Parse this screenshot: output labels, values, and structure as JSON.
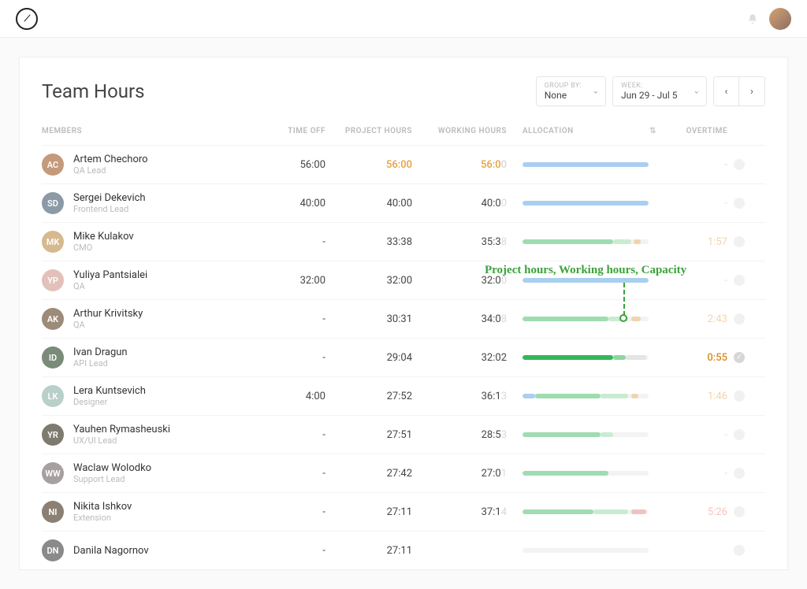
{
  "page_title": "Team Hours",
  "groupby": {
    "label": "GROUP BY:",
    "value": "None"
  },
  "weeksel": {
    "label": "WEEK:",
    "value": "Jun 29 - Jul 5"
  },
  "columns": {
    "members": "Members",
    "timeoff": "Time Off",
    "project_hours": "Project Hours",
    "working_hours": "Working Hours",
    "allocation": "Allocation",
    "overtime": "Overtime"
  },
  "annotation_text": "Project hours, Working hours, Capacity",
  "members": [
    {
      "name": "Artem Chechoro",
      "role": "QA Lead",
      "avatar": "AC",
      "timeoff": "56:00",
      "project": {
        "text": "56:00",
        "style": "highlight"
      },
      "working": {
        "main": "56:0",
        "suffix": "0",
        "style": "highlight"
      },
      "alloc": {
        "segs": [
          {
            "l": 0,
            "w": 100,
            "color": "#a9cff0"
          }
        ]
      },
      "overtime": {
        "text": "-",
        "cls": "ot-none"
      },
      "status": "empty"
    },
    {
      "name": "Sergei Dekevich",
      "role": "Frontend Lead",
      "avatar": "SD",
      "timeoff": "40:00",
      "project": {
        "text": "40:00",
        "style": ""
      },
      "working": {
        "main": "40:0",
        "suffix": "0"
      },
      "alloc": {
        "segs": [
          {
            "l": 0,
            "w": 100,
            "color": "#a9cff0"
          }
        ]
      },
      "overtime": {
        "text": "-",
        "cls": "ot-none"
      },
      "status": "empty"
    },
    {
      "name": "Mike Kulakov",
      "role": "CMO",
      "avatar": "MK",
      "timeoff": "-",
      "project": {
        "text": "33:38",
        "style": ""
      },
      "working": {
        "main": "35:3",
        "suffix": "8"
      },
      "alloc": {
        "segs": [
          {
            "l": 0,
            "w": 72,
            "color": "#9fdcb1"
          },
          {
            "l": 72,
            "w": 14,
            "color": "#c9ecd1"
          },
          {
            "l": 88,
            "w": 6,
            "color": "#f0d4ad"
          }
        ]
      },
      "overtime": {
        "text": "1:57",
        "cls": "ot-faint"
      },
      "status": "empty"
    },
    {
      "name": "Yuliya Pantsialei",
      "role": "QA",
      "avatar": "YP",
      "timeoff": "32:00",
      "project": {
        "text": "32:00",
        "style": ""
      },
      "working": {
        "main": "32:0",
        "suffix": "0"
      },
      "alloc": {
        "segs": [
          {
            "l": 0,
            "w": 100,
            "color": "#a9cff0"
          }
        ]
      },
      "overtime": {
        "text": "-",
        "cls": "ot-none"
      },
      "status": "empty"
    },
    {
      "name": "Arthur Krivitsky",
      "role": "QA",
      "avatar": "AK",
      "timeoff": "-",
      "project": {
        "text": "30:31",
        "style": ""
      },
      "working": {
        "main": "34:0",
        "suffix": "8"
      },
      "alloc": {
        "segs": [
          {
            "l": 0,
            "w": 68,
            "color": "#9fdcb1"
          },
          {
            "l": 68,
            "w": 16,
            "color": "#c9ecd1"
          },
          {
            "l": 86,
            "w": 8,
            "color": "#f0d4ad"
          }
        ]
      },
      "overtime": {
        "text": "2:43",
        "cls": "ot-faint"
      },
      "status": "empty"
    },
    {
      "name": "Ivan Dragun",
      "role": "API Lead",
      "avatar": "ID",
      "timeoff": "-",
      "project": {
        "text": "29:04",
        "style": ""
      },
      "working": {
        "main": "32:02",
        "suffix": ""
      },
      "alloc": {
        "segs": [
          {
            "l": 0,
            "w": 72,
            "color": "#34b65a"
          },
          {
            "l": 72,
            "w": 10,
            "color": "#8cd79e"
          },
          {
            "l": 82,
            "w": 16,
            "color": "#e5e5e5"
          }
        ]
      },
      "overtime": {
        "text": "0:55",
        "cls": "ot-strong"
      },
      "status": "checked"
    },
    {
      "name": "Lera Kuntsevich",
      "role": "Designer",
      "avatar": "LK",
      "timeoff": "4:00",
      "project": {
        "text": "27:52",
        "style": ""
      },
      "working": {
        "main": "36:1",
        "suffix": "3"
      },
      "alloc": {
        "segs": [
          {
            "l": 0,
            "w": 10,
            "color": "#a9cff0"
          },
          {
            "l": 10,
            "w": 52,
            "color": "#9fdcb1"
          },
          {
            "l": 62,
            "w": 22,
            "color": "#c9ecd1"
          },
          {
            "l": 86,
            "w": 6,
            "color": "#f0d4ad"
          }
        ]
      },
      "overtime": {
        "text": "1:46",
        "cls": "ot-faint"
      },
      "status": "empty"
    },
    {
      "name": "Yauhen Rymasheuski",
      "role": "UX/UI Lead",
      "avatar": "YR",
      "timeoff": "-",
      "project": {
        "text": "27:51",
        "style": ""
      },
      "working": {
        "main": "28:5",
        "suffix": "3"
      },
      "alloc": {
        "segs": [
          {
            "l": 0,
            "w": 62,
            "color": "#9fdcb1"
          },
          {
            "l": 62,
            "w": 10,
            "color": "#c9ecd1"
          }
        ]
      },
      "overtime": {
        "text": "-",
        "cls": "ot-none"
      },
      "status": "empty"
    },
    {
      "name": "Waclaw Wolodko",
      "role": "Support Lead",
      "avatar": "WW",
      "timeoff": "-",
      "project": {
        "text": "27:42",
        "style": ""
      },
      "working": {
        "main": "27:0",
        "suffix": "1"
      },
      "alloc": {
        "segs": [
          {
            "l": 0,
            "w": 68,
            "color": "#9fdcb1"
          }
        ]
      },
      "overtime": {
        "text": "-",
        "cls": "ot-none"
      },
      "status": "empty"
    },
    {
      "name": "Nikita Ishkov",
      "role": "Extension",
      "avatar": "NI",
      "timeoff": "-",
      "project": {
        "text": "27:11",
        "style": ""
      },
      "working": {
        "main": "37:1",
        "suffix": "4"
      },
      "alloc": {
        "segs": [
          {
            "l": 0,
            "w": 56,
            "color": "#9fdcb1"
          },
          {
            "l": 56,
            "w": 28,
            "color": "#c9ecd1"
          },
          {
            "l": 86,
            "w": 12,
            "color": "#f0c2c0"
          }
        ]
      },
      "overtime": {
        "text": "5:26",
        "cls": "ot-faint-red"
      },
      "status": "empty"
    },
    {
      "name": "Danila Nagornov",
      "role": "",
      "avatar": "DN",
      "timeoff": "-",
      "project": {
        "text": "27:11",
        "style": ""
      },
      "working": {
        "main": "",
        "suffix": ""
      },
      "alloc": {
        "segs": []
      },
      "overtime": {
        "text": "",
        "cls": "ot-none"
      },
      "status": "empty"
    }
  ]
}
